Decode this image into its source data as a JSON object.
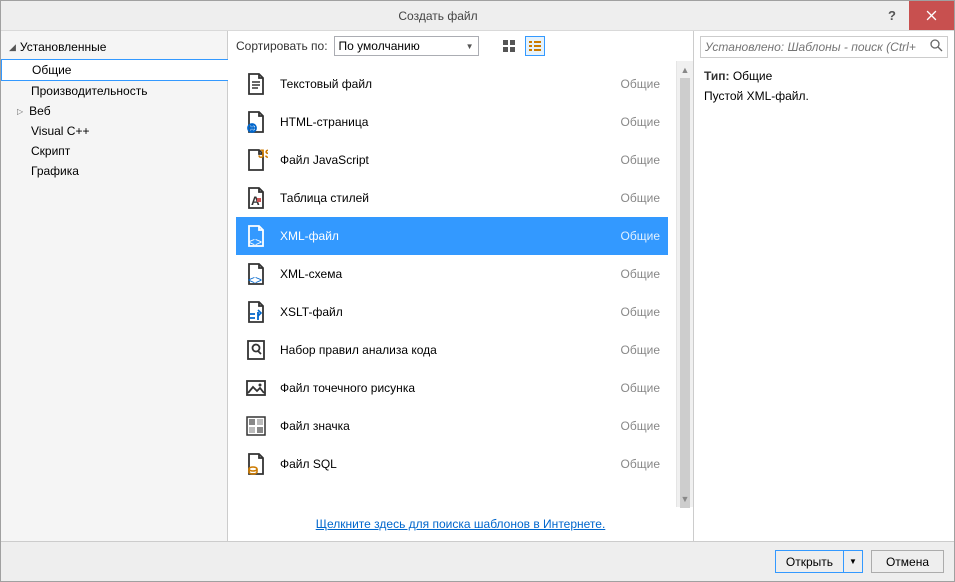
{
  "title": "Создать файл",
  "sidebar": {
    "header": "Установленные",
    "items": [
      {
        "label": "Общие",
        "selected": true
      },
      {
        "label": "Производительность"
      },
      {
        "label": "Веб",
        "expandable": true
      },
      {
        "label": "Visual C++"
      },
      {
        "label": "Скрипт"
      },
      {
        "label": "Графика"
      }
    ]
  },
  "toolbar": {
    "sort_label": "Сортировать по:",
    "sort_value": "По умолчанию"
  },
  "templates": [
    {
      "name": "Текстовый файл",
      "category": "Общие",
      "icon": "text"
    },
    {
      "name": "HTML-страница",
      "category": "Общие",
      "icon": "html"
    },
    {
      "name": "Файл JavaScript",
      "category": "Общие",
      "icon": "js"
    },
    {
      "name": "Таблица стилей",
      "category": "Общие",
      "icon": "css"
    },
    {
      "name": "XML-файл",
      "category": "Общие",
      "icon": "xml",
      "selected": true
    },
    {
      "name": "XML-схема",
      "category": "Общие",
      "icon": "xsd"
    },
    {
      "name": "XSLT-файл",
      "category": "Общие",
      "icon": "xslt"
    },
    {
      "name": "Набор правил анализа кода",
      "category": "Общие",
      "icon": "rules"
    },
    {
      "name": "Файл точечного рисунка",
      "category": "Общие",
      "icon": "bmp"
    },
    {
      "name": "Файл значка",
      "category": "Общие",
      "icon": "ico"
    },
    {
      "name": "Файл SQL",
      "category": "Общие",
      "icon": "sql"
    }
  ],
  "footer_link": "Щелкните здесь для поиска шаблонов в Интернете.",
  "search": {
    "placeholder": "Установлено: Шаблоны - поиск (Ctrl+"
  },
  "details": {
    "type_label": "Тип:",
    "type_value": "Общие",
    "description": "Пустой XML-файл."
  },
  "buttons": {
    "open": "Открыть",
    "cancel": "Отмена"
  }
}
